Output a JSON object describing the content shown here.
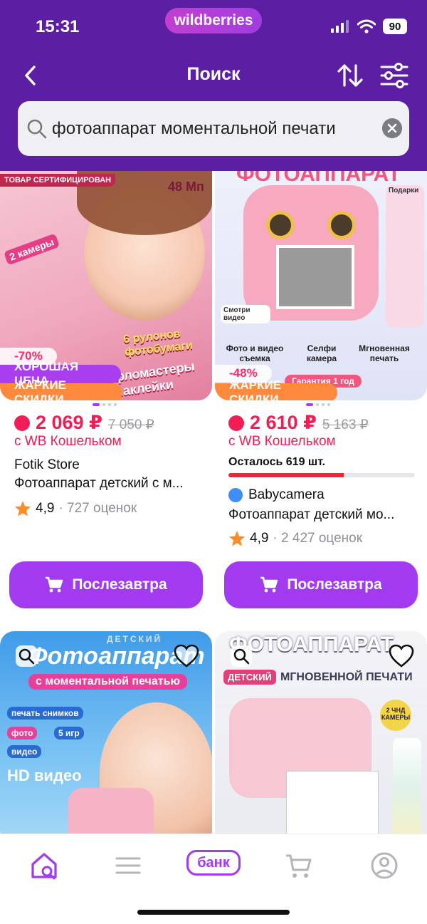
{
  "status": {
    "time": "15:31",
    "brand": "wildberries",
    "battery": "90"
  },
  "nav": {
    "title": "Поиск"
  },
  "search": {
    "query": "фотоаппарат моментальной печати"
  },
  "products": [
    {
      "image_texts": {
        "certified": "ТОВАР СЕРТИФИЦИРОВАН",
        "mp": "48 Мп",
        "cameras": "2 камеры",
        "rolls": "6 рулонов фотобумаги",
        "markers": "фломастеры наклейки"
      },
      "discount": "-70%",
      "badge_good": "ХОРОШАЯ ЦЕНА",
      "badge_hot": "ЖАРКИЕ СКИДКИ",
      "price": "2 069 ₽",
      "old_price": "7 050 ₽",
      "wallet": "с WB Кошельком",
      "seller": "Fotik Store",
      "title": "Фотоаппарат детский с м...",
      "rating": "4,9",
      "reviews": "· 727 оценок",
      "button": "Послезавтра"
    },
    {
      "image_texts": {
        "header": "ФОТОАППАРАТ",
        "gifts": "Подарки",
        "video": "Смотри видео",
        "f1": "Фото и видео съемка",
        "f2": "Селфи камера",
        "f3": "Мгновенная печать",
        "warranty": "Гарантия 1 год"
      },
      "discount": "-48%",
      "badge_hot": "ЖАРКИЕ СКИДКИ",
      "price": "2 610 ₽",
      "old_price": "5 163 ₽",
      "wallet": "с WB Кошельком",
      "stock": "Осталось 619 шт.",
      "stock_fill": 0.62,
      "seller": "Babycamera",
      "title": "Фотоаппарат детский мо...",
      "rating": "4,9",
      "reviews": "· 2 427 оценок",
      "button": "Послезавтра"
    },
    {
      "image_texts": {
        "small": "детский",
        "header": "Фотоаппарат",
        "sub": "с моментальной печатью",
        "p1": "печать снимков",
        "p2": "фото",
        "p3": "5 игр",
        "p4": "видео",
        "hd": "HD видео"
      }
    },
    {
      "image_texts": {
        "header": "ФОТОАППАРАТ",
        "kids": "ДЕТСКИЙ",
        "sub": "МГНОВЕННОЙ ПЕЧАТИ",
        "cam": "2 ЧНД КАМЕРЫ"
      }
    }
  ],
  "bottom_nav": {
    "bank": "банк"
  },
  "colors": {
    "header": "#5c1fa3",
    "accent": "#a23af0",
    "price": "#f21d54",
    "hot_badge": "#ff8a3d",
    "good_badge": "#a93df0"
  }
}
